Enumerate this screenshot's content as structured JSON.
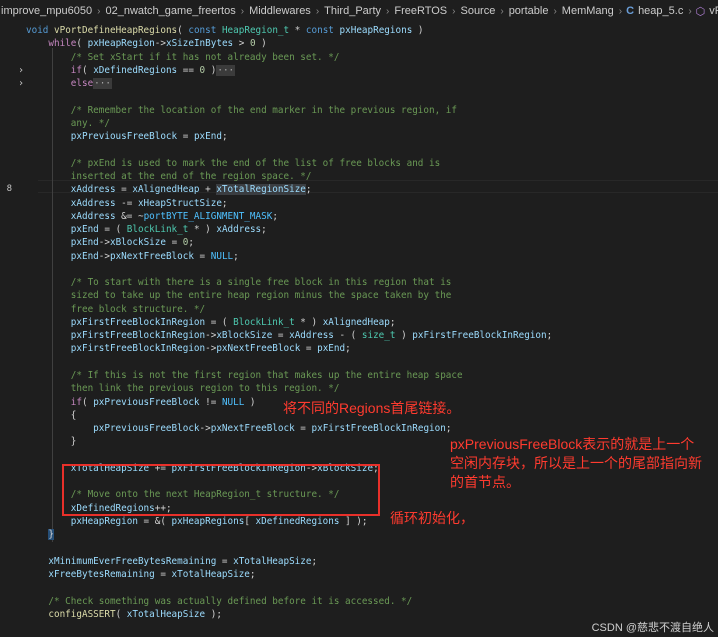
{
  "breadcrumb": [
    "improve_mpu6050",
    "02_nwatch_game_freertos",
    "Middlewares",
    "Third_Party",
    "FreeRTOS",
    "Source",
    "portable",
    "MemMang",
    "heap_5.c",
    "vPortDefineHeapRegions(cons"
  ],
  "breadcrumb_icons": {
    "file": "c-file-icon",
    "function": "function-cube-icon"
  },
  "annotations": {
    "link": "将不同的Regions首尾链接。",
    "prev_block": "pxPreviousFreeBlock表示的就是上一个空闲内存块，所以是上一个的尾部指向新的首节点。",
    "loop_init": "循环初始化，"
  },
  "watermark": "CSDN @慈悲不渡自绝人",
  "colors": {
    "annotation": "#ff3b2f",
    "box": "#e8302a",
    "background": "#1e1e1e"
  },
  "code_lines": [
    {
      "n": "",
      "fold": "",
      "html": "<span class=\"kw\">void</span> <span class=\"fn\">vPortDefineHeapRegions</span>( <span class=\"kw\">const</span> <span class=\"ty\">HeapRegion_t</span> * <span class=\"kw\">const</span> <span class=\"vr\">pxHeapRegions</span> )"
    },
    {
      "n": "",
      "fold": "",
      "html": "    <span class=\"ctl\">while</span>( <span class=\"vr\">pxHeapRegion</span>-><span class=\"vr\">xSizeInBytes</span> > <span class=\"nm\">0</span> )"
    },
    {
      "n": "",
      "fold": "",
      "html": "        <span class=\"cm\">/* Set xStart if it has not already been set. */</span>"
    },
    {
      "n": "",
      "fold": "›",
      "html": "        <span class=\"ctl\">if</span>( <span class=\"vr\">xDefinedRegions</span> == <span class=\"nm\">0</span> )<span class=\"collapse-dots\">···</span>"
    },
    {
      "n": "",
      "fold": "›",
      "html": "        <span class=\"ctl\">else</span><span class=\"collapse-dots\">···</span>"
    },
    {
      "n": "",
      "fold": "",
      "html": ""
    },
    {
      "n": "",
      "fold": "",
      "html": "        <span class=\"cm\">/* Remember the location of the end marker in the previous region, if</span>"
    },
    {
      "n": "",
      "fold": "",
      "html": "        <span class=\"cm\">any. */</span>"
    },
    {
      "n": "",
      "fold": "",
      "html": "        <span class=\"vr\">pxPreviousFreeBlock</span> = <span class=\"vr\">pxEnd</span>;"
    },
    {
      "n": "",
      "fold": "",
      "html": ""
    },
    {
      "n": "",
      "fold": "",
      "html": "        <span class=\"cm\">/* pxEnd is used to mark the end of the list of free blocks and is</span>"
    },
    {
      "n": "",
      "fold": "",
      "html": "        <span class=\"cm\">inserted at the end of the region space. */</span>"
    },
    {
      "n": "8",
      "fold": "",
      "html": "        <span class=\"vr\">xAddress</span> = <span class=\"vr\">xAlignedHeap</span> + <span class=\"vr hl\">xTotalRegionSize</span>;"
    },
    {
      "n": "",
      "fold": "",
      "html": "        <span class=\"vr\">xAddress</span> -= <span class=\"vr\">xHeapStructSize</span>;"
    },
    {
      "n": "",
      "fold": "",
      "html": "        <span class=\"vr\">xAddress</span> &amp;= ~<span class=\"mc\">portBYTE_ALIGNMENT_MASK</span>;"
    },
    {
      "n": "",
      "fold": "",
      "html": "        <span class=\"vr\">pxEnd</span> = ( <span class=\"ty\">BlockLink_t</span> * ) <span class=\"vr\">xAddress</span>;"
    },
    {
      "n": "",
      "fold": "",
      "html": "        <span class=\"vr\">pxEnd</span>-><span class=\"vr\">xBlockSize</span> = <span class=\"nm\">0</span>;"
    },
    {
      "n": "",
      "fold": "",
      "html": "        <span class=\"vr\">pxEnd</span>-><span class=\"vr\">pxNextFreeBlock</span> = <span class=\"mc\">NULL</span>;"
    },
    {
      "n": "",
      "fold": "",
      "html": ""
    },
    {
      "n": "",
      "fold": "",
      "html": "        <span class=\"cm\">/* To start with there is a single free block in this region that is</span>"
    },
    {
      "n": "",
      "fold": "",
      "html": "        <span class=\"cm\">sized to take up the entire heap region minus the space taken by the</span>"
    },
    {
      "n": "",
      "fold": "",
      "html": "        <span class=\"cm\">free block structure. */</span>"
    },
    {
      "n": "",
      "fold": "",
      "html": "        <span class=\"vr\">pxFirstFreeBlockInRegion</span> = ( <span class=\"ty\">BlockLink_t</span> * ) <span class=\"vr\">xAlignedHeap</span>;"
    },
    {
      "n": "",
      "fold": "",
      "html": "        <span class=\"vr\">pxFirstFreeBlockInRegion</span>-><span class=\"vr\">xBlockSize</span> = <span class=\"vr\">xAddress</span> - ( <span class=\"ty\">size_t</span> ) <span class=\"vr\">pxFirstFreeBlockInRegion</span>;"
    },
    {
      "n": "",
      "fold": "",
      "html": "        <span class=\"vr\">pxFirstFreeBlockInRegion</span>-><span class=\"vr\">pxNextFreeBlock</span> = <span class=\"vr\">pxEnd</span>;"
    },
    {
      "n": "",
      "fold": "",
      "html": ""
    },
    {
      "n": "",
      "fold": "",
      "html": "        <span class=\"cm\">/* If this is not the first region that makes up the entire heap space</span>"
    },
    {
      "n": "",
      "fold": "",
      "html": "        <span class=\"cm\">then link the previous region to this region. */</span>"
    },
    {
      "n": "",
      "fold": "",
      "html": "        <span class=\"ctl\">if</span>( <span class=\"vr\">pxPreviousFreeBlock</span> != <span class=\"mc\">NULL</span> )"
    },
    {
      "n": "",
      "fold": "",
      "html": "        {"
    },
    {
      "n": "",
      "fold": "",
      "html": "            <span class=\"vr\">pxPreviousFreeBlock</span>-><span class=\"vr\">pxNextFreeBlock</span> = <span class=\"vr\">pxFirstFreeBlockInRegion</span>;"
    },
    {
      "n": "",
      "fold": "",
      "html": "        }"
    },
    {
      "n": "",
      "fold": "",
      "html": ""
    },
    {
      "n": "",
      "fold": "",
      "html": "        <span class=\"vr\">xTotalHeapSize</span> += <span class=\"vr\">pxFirstFreeBlockInRegion</span>-><span class=\"vr\">xBlockSize</span>;"
    },
    {
      "n": "",
      "fold": "",
      "html": ""
    },
    {
      "n": "",
      "fold": "",
      "html": "        <span class=\"cm\">/* Move onto the next HeapRegion_t structure. */</span>"
    },
    {
      "n": "",
      "fold": "",
      "html": "        <span class=\"vr\">xDefinedRegions</span>++;"
    },
    {
      "n": "",
      "fold": "",
      "html": "        <span class=\"vr\">pxHeapRegion</span> = &amp;( <span class=\"vr\">pxHeapRegions</span>[ <span class=\"vr\">xDefinedRegions</span> ] );"
    },
    {
      "n": "",
      "fold": "",
      "html": "    <span class=\"endcursor\">}</span>"
    },
    {
      "n": "",
      "fold": "",
      "html": ""
    },
    {
      "n": "",
      "fold": "",
      "html": "    <span class=\"vr\">xMinimumEverFreeBytesRemaining</span> = <span class=\"vr\">xTotalHeapSize</span>;"
    },
    {
      "n": "",
      "fold": "",
      "html": "    <span class=\"vr\">xFreeBytesRemaining</span> = <span class=\"vr\">xTotalHeapSize</span>;"
    },
    {
      "n": "",
      "fold": "",
      "html": ""
    },
    {
      "n": "",
      "fold": "",
      "html": "    <span class=\"cm\">/* Check something was actually defined before it is accessed. */</span>"
    },
    {
      "n": "",
      "fold": "",
      "html": "    <span class=\"fn\">configASSERT</span>( <span class=\"vr\">xTotalHeapSize</span> );"
    }
  ]
}
